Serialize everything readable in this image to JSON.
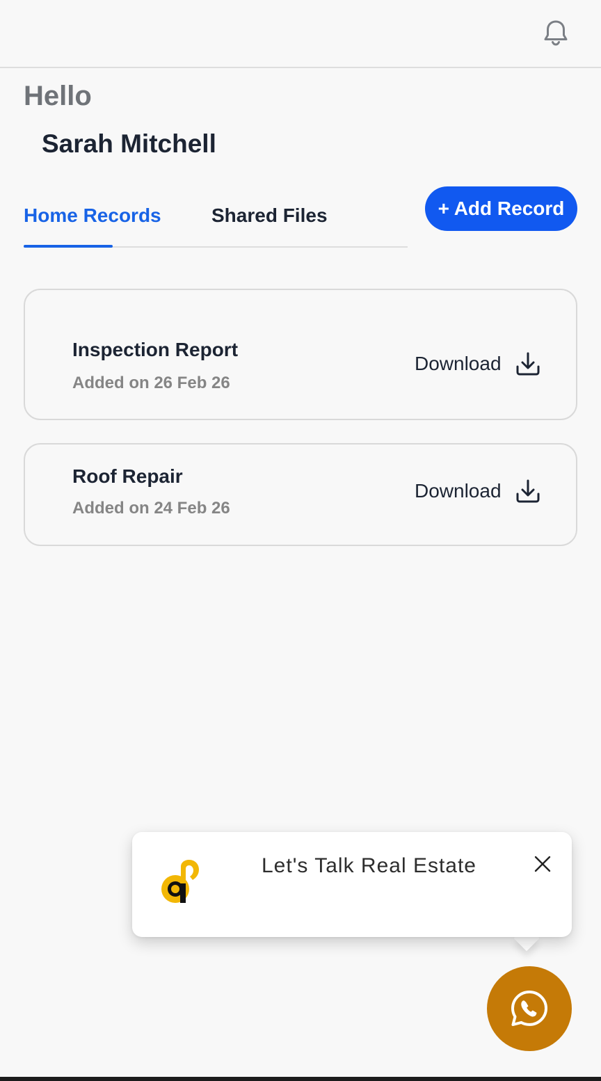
{
  "header": {
    "bell_icon": "bell-icon"
  },
  "greeting": {
    "hello": "Hello",
    "user_name": "Sarah Mitchell"
  },
  "tabs": [
    {
      "label": "Home Records",
      "active": true
    },
    {
      "label": "Shared Files",
      "active": false
    }
  ],
  "add_record_label": "+ Add Record",
  "records": [
    {
      "title": "Inspection  Report",
      "date": "Added on 26 Feb 26",
      "action": "Download"
    },
    {
      "title": "Roof Repair",
      "date": "Added on 24 Feb 26",
      "action": "Download"
    }
  ],
  "chat_popup": {
    "text": "Let's Talk Real Estate",
    "logo_icon": "brand-logo-icon",
    "close_icon": "close-icon"
  },
  "whatsapp_icon": "whatsapp-icon",
  "colors": {
    "accent": "#1863e6",
    "button": "#1159f0",
    "whatsapp_bg": "#c57a07",
    "logo_yellow": "#f2b705"
  }
}
